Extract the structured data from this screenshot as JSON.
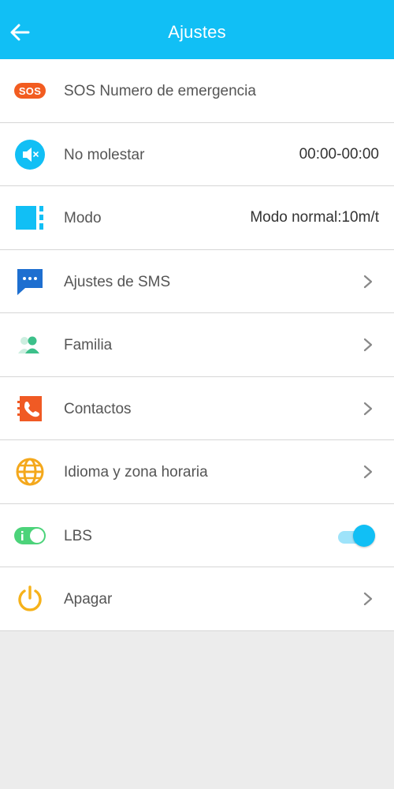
{
  "header": {
    "title": "Ajustes"
  },
  "rows": [
    {
      "label": "SOS Numero de emergencia",
      "icon": "sos-icon",
      "badge": "SOS"
    },
    {
      "label": "No molestar",
      "value": "00:00-00:00",
      "icon": "mute-speaker-icon"
    },
    {
      "label": "Modo",
      "value": "Modo normal:10m/t",
      "icon": "mode-icon"
    },
    {
      "label": "Ajustes de SMS",
      "icon": "sms-icon"
    },
    {
      "label": "Familia",
      "icon": "family-icon"
    },
    {
      "label": "Contactos",
      "icon": "contacts-icon"
    },
    {
      "label": "Idioma y zona horaria",
      "icon": "globe-icon"
    },
    {
      "label": "LBS",
      "icon": "lbs-toggle-icon",
      "toggle_on": true
    },
    {
      "label": "Apagar",
      "icon": "power-icon"
    }
  ],
  "colors": {
    "primary": "#11bff5",
    "sos": "#f25c20",
    "sms": "#1e6fd0",
    "family": "#3cc08a",
    "contacts": "#f05a24",
    "globe": "#f4a81c",
    "lbs": "#4cd37a",
    "power": "#f6b21a"
  }
}
